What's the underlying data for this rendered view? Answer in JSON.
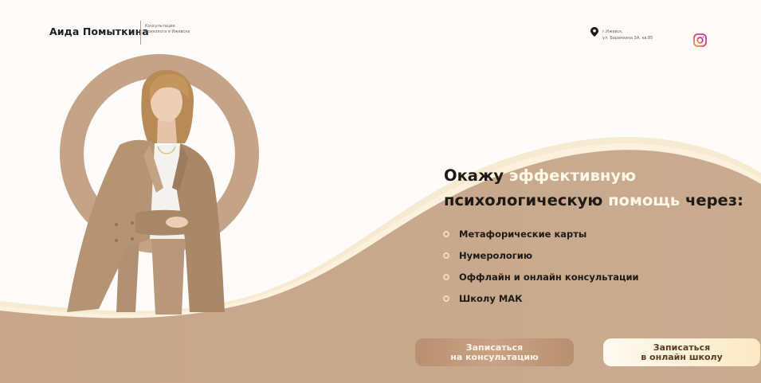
{
  "header": {
    "brand_name": "Аида Помыткина",
    "tagline_line1": "Консультации",
    "tagline_line2": "психолога в Ижевске",
    "address_line1": "г.Ижевск,",
    "address_line2": "ул. Барамзина 3А, кв.85"
  },
  "hero": {
    "headline": {
      "w1": "Окажу",
      "w2": "эффективную",
      "w3": "психологическую",
      "w4": "помощь",
      "w5": "через:"
    },
    "services": [
      {
        "label": "Метафорические карты"
      },
      {
        "label": "Нумерологию"
      },
      {
        "label": "Оффлайн и онлайн консультации"
      },
      {
        "label": "Школу МАК"
      }
    ]
  },
  "buttons": {
    "consult_line1": "Записаться",
    "consult_line2": "на консультацию",
    "school_line1": "Записаться",
    "school_line2": "в онлайн школу"
  },
  "colors": {
    "beige": "#c8a88c",
    "light_beige": "#f3e6c9",
    "cream_highlight": "#fff8e6",
    "text_dark": "#1f1a14",
    "instagram_accent": "#e4405f"
  },
  "icons": {
    "location": "location-pin-icon",
    "instagram": "instagram-icon",
    "bullet": "circle-bullet-icon"
  }
}
